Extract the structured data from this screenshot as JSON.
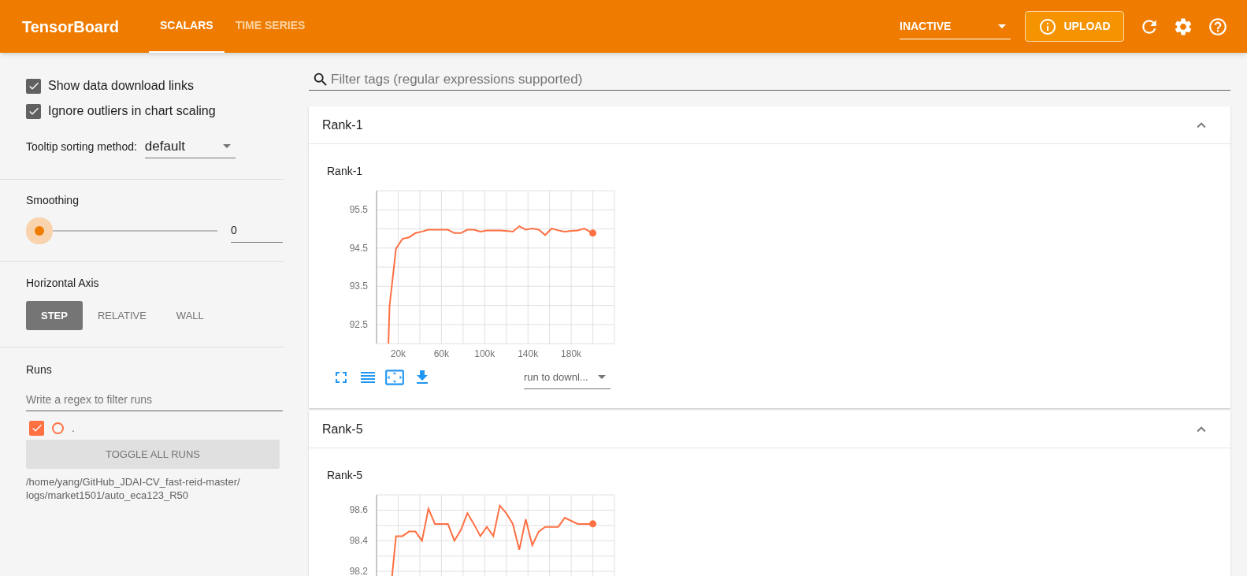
{
  "header": {
    "title": "TensorBoard",
    "tabs": [
      {
        "label": "SCALARS",
        "selected": true
      },
      {
        "label": "TIME SERIES",
        "selected": false
      }
    ],
    "run_selector": {
      "value": "INACTIVE"
    },
    "upload_button": "UPLOAD"
  },
  "sidebar": {
    "options": [
      {
        "label": "Show data download links",
        "checked": true
      },
      {
        "label": "Ignore outliers in chart scaling",
        "checked": true
      }
    ],
    "tooltip_sorting": {
      "label": "Tooltip sorting method:",
      "value": "default"
    },
    "smoothing": {
      "label": "Smoothing",
      "level": 0,
      "value": "0"
    },
    "horizontal_axis": {
      "label": "Horizontal Axis",
      "options": [
        {
          "label": "STEP",
          "selected": true
        },
        {
          "label": "RELATIVE",
          "selected": false
        },
        {
          "label": "WALL",
          "selected": false
        }
      ]
    },
    "runs": {
      "label": "Runs",
      "filter": {
        "placeholder": "Write a regex to filter runs"
      },
      "items": [
        {
          "name": ".",
          "checked": true,
          "color": "#ff7043"
        }
      ],
      "toggle_button": "TOGGLE ALL RUNS",
      "logdir_lines": [
        "/home/yang/GitHub_JDAI-CV_fast-reid-master/",
        "logs/market1501/auto_eca123_R50"
      ]
    }
  },
  "main": {
    "filter": {
      "placeholder": "Filter tags (regular expressions supported)"
    },
    "cards": [
      {
        "title": "Rank-1",
        "expanded": true,
        "charts": [
          {
            "title": "Rank-1",
            "run_select": "run to downl...",
            "chart_data": {
              "type": "line",
              "x": [
                11000,
                12000,
                18000,
                24000,
                30000,
                36000,
                42000,
                48000,
                54000,
                60000,
                66000,
                72000,
                78000,
                84000,
                90000,
                96000,
                102000,
                108000,
                114000,
                120000,
                126000,
                132000,
                138000,
                144000,
                150000,
                156000,
                162000,
                168000,
                174000,
                180000,
                186000,
                192000,
                200000
              ],
              "grid": true,
              "xlim": [
                0,
                220000
              ],
              "ylim": [
                92,
                96
              ],
              "xticks": [
                {
                  "value": 20000,
                  "label": "20k"
                },
                {
                  "value": 60000,
                  "label": "60k"
                },
                {
                  "value": 100000,
                  "label": "100k"
                },
                {
                  "value": 140000,
                  "label": "140k"
                },
                {
                  "value": 180000,
                  "label": "180k"
                }
              ],
              "yticks": [
                92.5,
                93.5,
                94.5,
                95.5
              ],
              "series": [
                {
                  "color": "#ff7043",
                  "values": [
                    92.0,
                    92.98,
                    94.48,
                    94.74,
                    94.78,
                    94.89,
                    94.93,
                    94.98,
                    94.98,
                    94.98,
                    94.98,
                    94.89,
                    94.89,
                    94.98,
                    94.98,
                    94.93,
                    94.96,
                    94.96,
                    94.96,
                    94.95,
                    94.93,
                    95.07,
                    94.98,
                    95.01,
                    94.98,
                    94.84,
                    95.01,
                    94.96,
                    94.93,
                    94.95,
                    94.96,
                    95.01,
                    94.89
                  ]
                }
              ]
            }
          }
        ]
      },
      {
        "title": "Rank-5",
        "expanded": true,
        "charts": [
          {
            "title": "Rank-5",
            "chart_data": {
              "type": "line",
              "x": [
                12000,
                18000,
                24000,
                30000,
                36000,
                42000,
                48000,
                54000,
                60000,
                66000,
                72000,
                78000,
                84000,
                90000,
                96000,
                102000,
                108000,
                114000,
                120000,
                126000,
                132000,
                138000,
                144000,
                150000,
                156000,
                162000,
                168000,
                174000,
                180000,
                186000,
                192000,
                200000
              ],
              "grid": true,
              "xlim": [
                0,
                220000
              ],
              "ylim": [
                97.7,
                98.7
              ],
              "yticks": [
                98.2,
                98.4,
                98.6
              ],
              "series": [
                {
                  "color": "#ff7043",
                  "values": [
                    98.0,
                    98.43,
                    98.43,
                    98.46,
                    98.46,
                    98.4,
                    98.61,
                    98.51,
                    98.51,
                    98.51,
                    98.4,
                    98.47,
                    98.58,
                    98.51,
                    98.43,
                    98.49,
                    98.43,
                    98.63,
                    98.58,
                    98.51,
                    98.34,
                    98.54,
                    98.37,
                    98.46,
                    98.49,
                    98.49,
                    98.49,
                    98.55,
                    98.53,
                    98.51,
                    98.51,
                    98.51
                  ]
                }
              ]
            }
          }
        ]
      }
    ]
  }
}
